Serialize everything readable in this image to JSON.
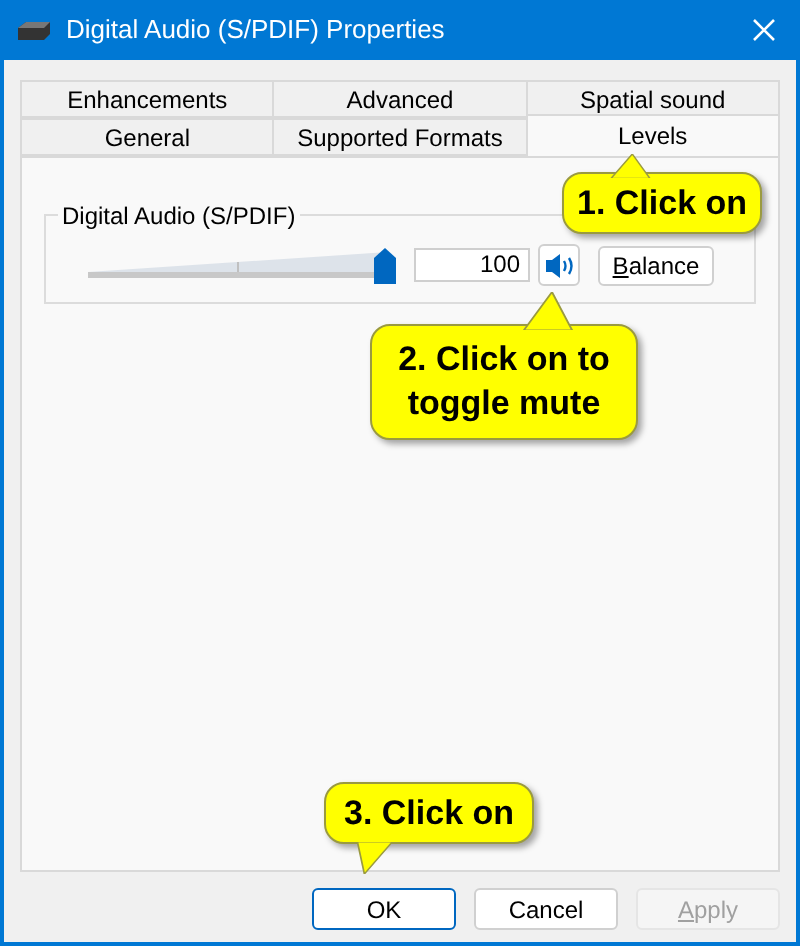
{
  "window": {
    "title": "Digital Audio (S/PDIF) Properties"
  },
  "tab_rows": [
    {
      "tabs": [
        {
          "label": "Enhancements",
          "selected": false
        },
        {
          "label": "Advanced",
          "selected": false
        },
        {
          "label": "Spatial sound",
          "selected": false
        }
      ]
    },
    {
      "tabs": [
        {
          "label": "General",
          "selected": false
        },
        {
          "label": "Supported Formats",
          "selected": false
        },
        {
          "label": "Levels",
          "selected": true
        }
      ]
    }
  ],
  "levels": [
    {
      "name": "Digital Audio (S/PDIF)",
      "level": 1.0,
      "reading": "100",
      "muted": false,
      "balance_button": "Balance"
    }
  ],
  "buttons": [
    {
      "label": "OK",
      "default": true,
      "disabled": false
    },
    {
      "label": "Cancel",
      "default": false,
      "disabled": false
    },
    {
      "label": "Apply",
      "default": false,
      "disabled": true
    }
  ],
  "callouts": [
    {
      "text": "1. Click on"
    },
    {
      "text": "2. Click on to toggle mute"
    },
    {
      "text": "3. Click on"
    }
  ]
}
